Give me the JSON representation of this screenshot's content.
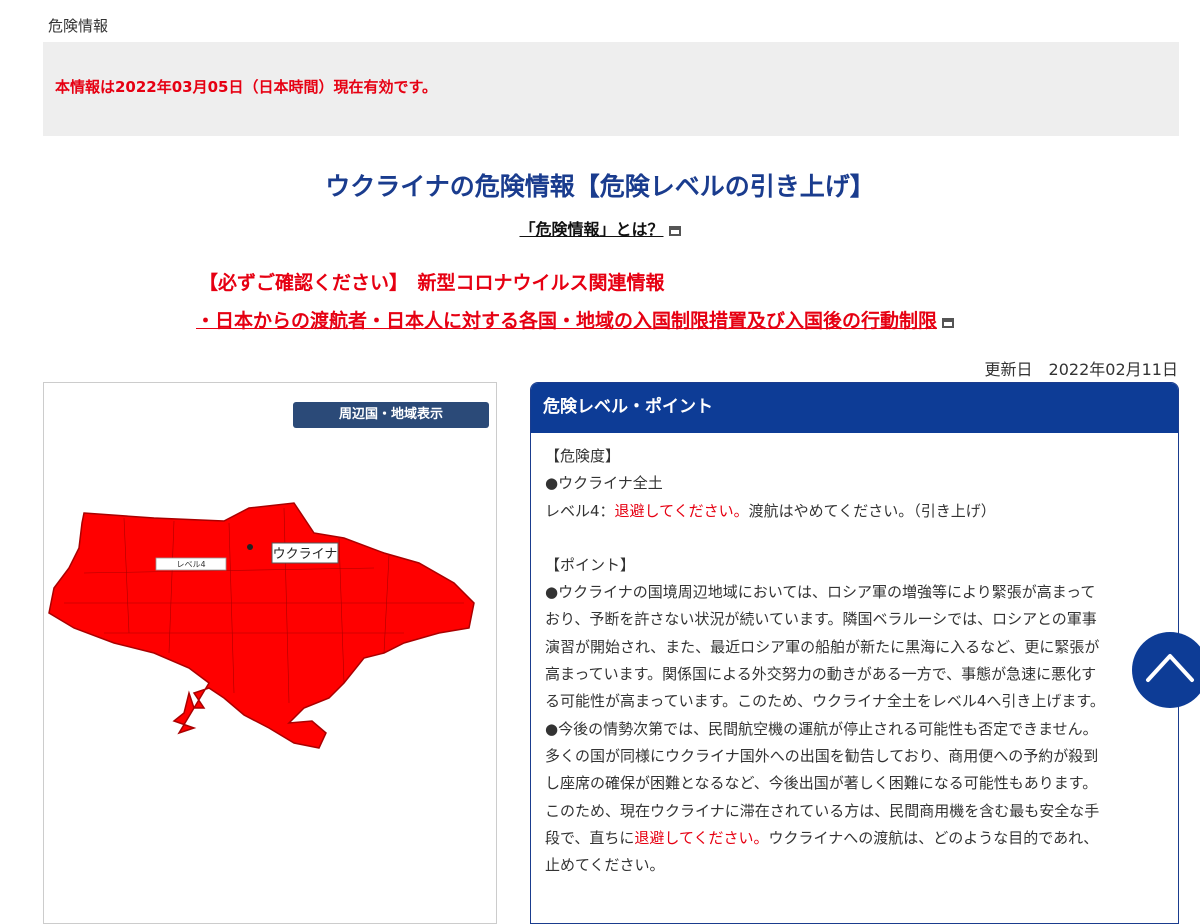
{
  "breadcrumb": "危険情報",
  "notice": "本情報は2022年03月05日（日本時間）現在有効です。",
  "title": "ウクライナの危険情報【危険レベルの引き上げ】",
  "what_link": "「危険情報」とは？",
  "covid": {
    "heading": "【必ずご確認ください】　新型コロナウイルス関連情報",
    "link": "・日本からの渡航者・日本人に対する各国・地域の入国制限措置及び入国後の行動制限"
  },
  "updated": "更新日　2022年02月11日",
  "map": {
    "button": "周辺国・地域表示",
    "country_label": "ウクライナ",
    "level_label": "レベル4",
    "fill_color": "#ff0000"
  },
  "panel": {
    "header": "危険レベル・ポイント",
    "danger_heading": "【危険度】",
    "danger_area": "●ウクライナ全土",
    "level_prefix": "レベル4：",
    "level_red": "退避してください。",
    "level_suffix": "渡航はやめてください。（引き上げ）",
    "points_heading": "【ポイント】",
    "lines": [
      "●ウクライナの国境周辺地域においては、ロシア軍の増強等により緊張が高まって",
      "おり、予断を許さない状況が続いています。隣国ベラルーシでは、ロシアとの軍事",
      "演習が開始され、また、最近ロシア軍の船舶が新たに黒海に入るなど、更に緊張が",
      "高まっています。関係国による外交努力の動きがある一方で、事態が急速に悪化す",
      "る可能性が高まっています。このため、ウクライナ全土をレベル4へ引き上げます。",
      "●今後の情勢次第では、民間航空機の運航が停止される可能性も否定できません。",
      "多くの国が同様にウクライナ国外への出国を勧告しており、商用便への予約が殺到",
      "し座席の確保が困難となるなど、今後出国が著しく困難になる可能性もあります。",
      "このため、現在ウクライナに滞在されている方は、民間商用機を含む最も安全な手"
    ],
    "last_pre": "段で、直ちに",
    "last_red": "退避してください。",
    "last_post": "ウクライナへの渡航は、どのような目的であれ、",
    "final": "止めてください。"
  }
}
